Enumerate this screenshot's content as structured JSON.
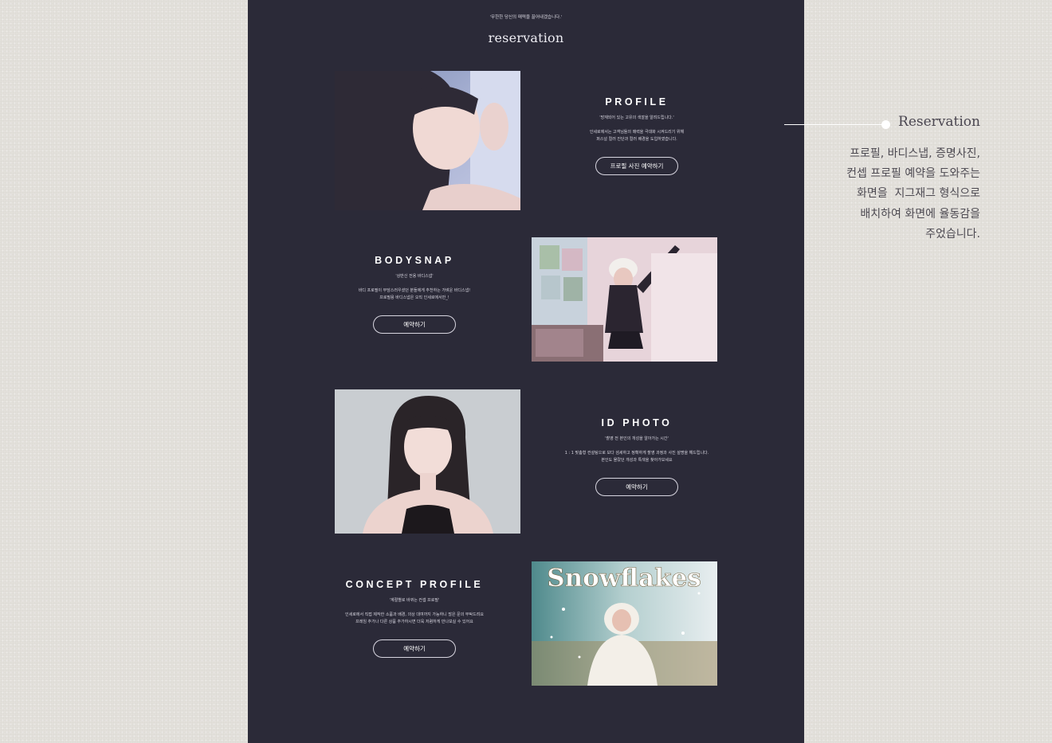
{
  "page": {
    "tagline": "'무한한 당신의 매력을 끌어내겠습니다.'",
    "logo": "reservation"
  },
  "sections": [
    {
      "title": "PROFILE",
      "subtitle": "'망재되어 있는 고유의 색깔을 알려드립니다.'",
      "description": [
        "인세로에서는 고객님들의 매력을 극대화 시켜드리기 위해",
        "퍼스널 컬러 진단과 컬러 배경을 도입하였습니다."
      ],
      "button": "프로필 사진 예약하기"
    },
    {
      "title": "BODYSNAP",
      "subtitle": "'상반신 전용 바디스냅'",
      "description": [
        "바디 프로필이 부담스러우셨던 분들에게 추천하는 가벼운 바디스냅!",
        "프로필용 바디스냅은 오직 인세로에서만_!"
      ],
      "button": "예약하기"
    },
    {
      "title": "ID PHOTO",
      "subtitle": "'촬영 전 본인의 개성을 알아가는 시간'",
      "description": [
        "1 : 1 맞춤형 컨설팅으로 보다 섬세하고 정확하게 촬영 과정과 사진 설명을 해드립니다.",
        "본인도 몰랐던 개성과 특색을 찾아가보세요"
      ],
      "button": "예약하기"
    },
    {
      "title": "CONCEPT PROFILE",
      "subtitle": "'계절별로 바뀌는 컨셉 프로필'",
      "description": [
        "인세로에서 직접 제작한 소품과 배경, 의상 대여까지 가능하니 많은 문의 부탁드려요",
        "프레임 추가나 다른 상품 추가하시면 더욱 저렴하게 만나보실 수 있어요"
      ],
      "button": "예약하기",
      "image_text": "Snowflakes"
    }
  ],
  "annotation": {
    "title": "Reservation",
    "lines": [
      "프로필, 바디스냅, 증명사진,",
      "컨셉 프로필 예약을 도와주는",
      "화면을  지그재그 형식으로",
      "배치하여 화면에 율동감을",
      "주었습니다."
    ]
  },
  "colors": {
    "background": "#e3e0db",
    "panel": "#2b2a38",
    "text_light": "#ffffff",
    "annotation_text": "#4d4a52"
  }
}
